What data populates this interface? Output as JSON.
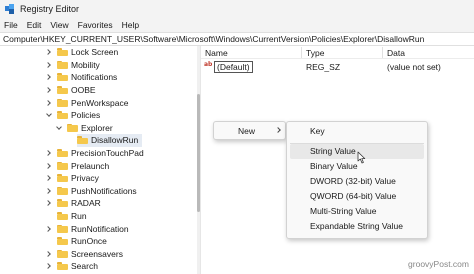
{
  "window": {
    "title": "Registry Editor"
  },
  "menu": [
    "File",
    "Edit",
    "View",
    "Favorites",
    "Help"
  ],
  "address": "Computer\\HKEY_CURRENT_USER\\Software\\Microsoft\\Windows\\CurrentVersion\\Policies\\Explorer\\DisallowRun",
  "tree": {
    "items": [
      {
        "label": "Lock Screen",
        "expander": "right"
      },
      {
        "label": "Mobility",
        "expander": "right"
      },
      {
        "label": "Notifications",
        "expander": "right"
      },
      {
        "label": "OOBE",
        "expander": "right"
      },
      {
        "label": "PenWorkspace",
        "expander": "right"
      },
      {
        "label": "Policies",
        "expander": "down"
      },
      {
        "label": "Explorer",
        "expander": "down"
      },
      {
        "label": "DisallowRun",
        "expander": "none",
        "selected": true
      },
      {
        "label": "PrecisionTouchPad",
        "expander": "right"
      },
      {
        "label": "Prelaunch",
        "expander": "right"
      },
      {
        "label": "Privacy",
        "expander": "right"
      },
      {
        "label": "PushNotifications",
        "expander": "right"
      },
      {
        "label": "RADAR",
        "expander": "right"
      },
      {
        "label": "Run",
        "expander": "none"
      },
      {
        "label": "RunNotification",
        "expander": "right"
      },
      {
        "label": "RunOnce",
        "expander": "none"
      },
      {
        "label": "Screensavers",
        "expander": "right"
      },
      {
        "label": "Search",
        "expander": "right"
      }
    ]
  },
  "list": {
    "columns": [
      "Name",
      "Type",
      "Data"
    ],
    "rows": [
      {
        "name": "(Default)",
        "type": "REG_SZ",
        "data": "(value not set)"
      }
    ]
  },
  "context_menu": {
    "new_label": "New",
    "submenu": [
      {
        "label": "Key"
      },
      {
        "label": "String Value",
        "hover": true
      },
      {
        "label": "Binary Value"
      },
      {
        "label": "DWORD (32-bit) Value"
      },
      {
        "label": "QWORD (64-bit) Value"
      },
      {
        "label": "Multi-String Value"
      },
      {
        "label": "Expandable String Value"
      }
    ]
  },
  "watermark": "groovyPost.com",
  "colors": {
    "folder": "#f5c84c",
    "selection": "#e5ebf3",
    "menu_hover": "#e8e8e8"
  }
}
